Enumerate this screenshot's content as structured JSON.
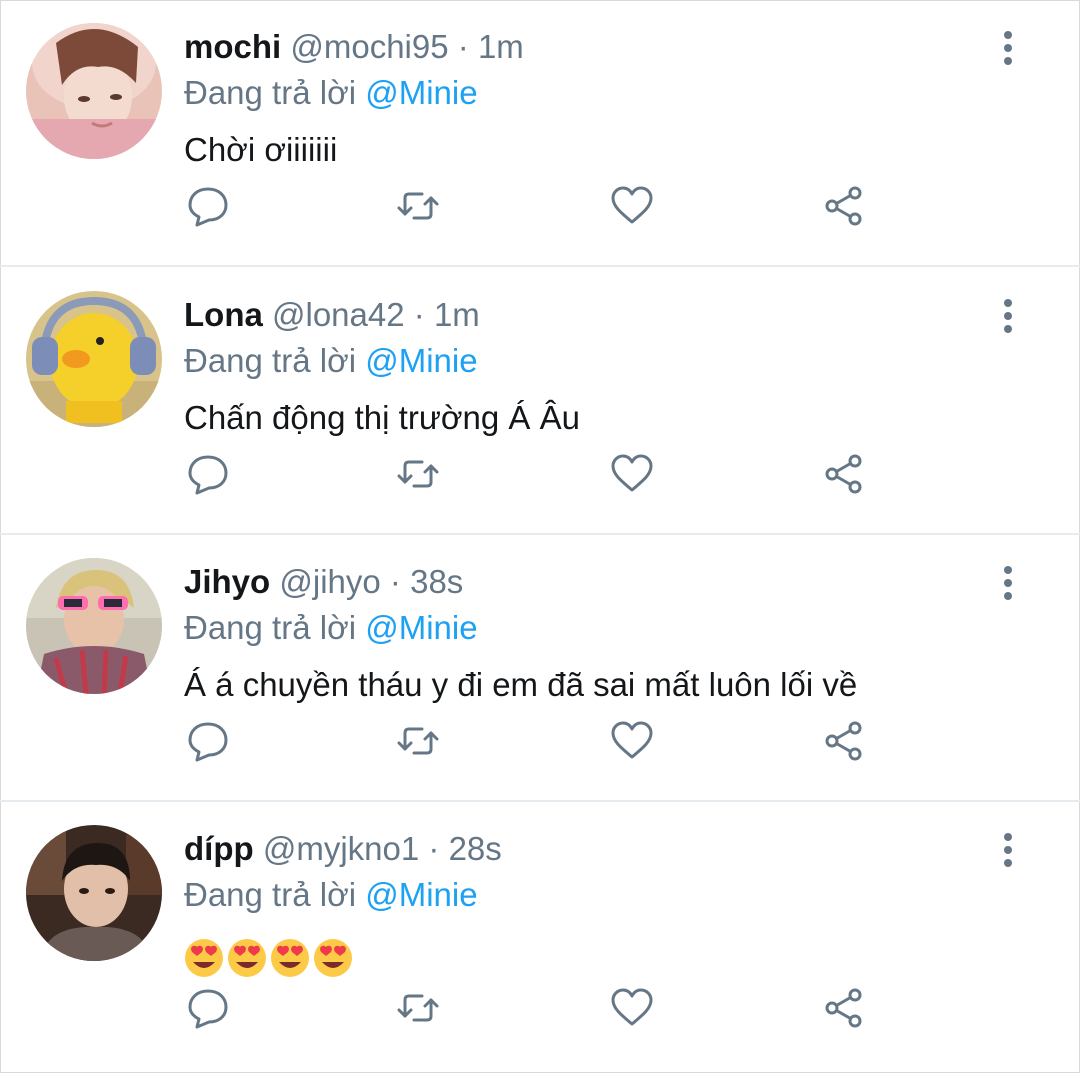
{
  "thread": {
    "tweets": [
      {
        "name": "mochi",
        "handle": "@mochi95",
        "time": "1m",
        "reply_prefix": "Đang trả lời",
        "reply_to": "@Minie",
        "text": "Chời ơiiiiiii"
      },
      {
        "name": "Lona",
        "handle": "@lona42",
        "time": "1m",
        "reply_prefix": "Đang trả lời",
        "reply_to": "@Minie",
        "text": "Chấn động thị trường Á Âu"
      },
      {
        "name": "Jihyo",
        "handle": "@jihyo",
        "time": "38s",
        "reply_prefix": "Đang trả lời",
        "reply_to": "@Minie",
        "text": "Á á chuyền tháu y đi em đã sai mất luôn lối về"
      },
      {
        "name": "dípp",
        "handle": "@myjkno1",
        "time": "28s",
        "reply_prefix": "Đang trả lời",
        "reply_to": "@Minie",
        "text": "",
        "emoji": "heart-eyes-face x4"
      }
    ],
    "separator": "·"
  },
  "colors": {
    "accent": "#1da1f2",
    "secondary": "#657786",
    "text": "#14171a",
    "divider": "#e6ecf0"
  },
  "icons": [
    "reply-icon",
    "retweet-icon",
    "like-icon",
    "share-icon",
    "more-options-icon"
  ]
}
